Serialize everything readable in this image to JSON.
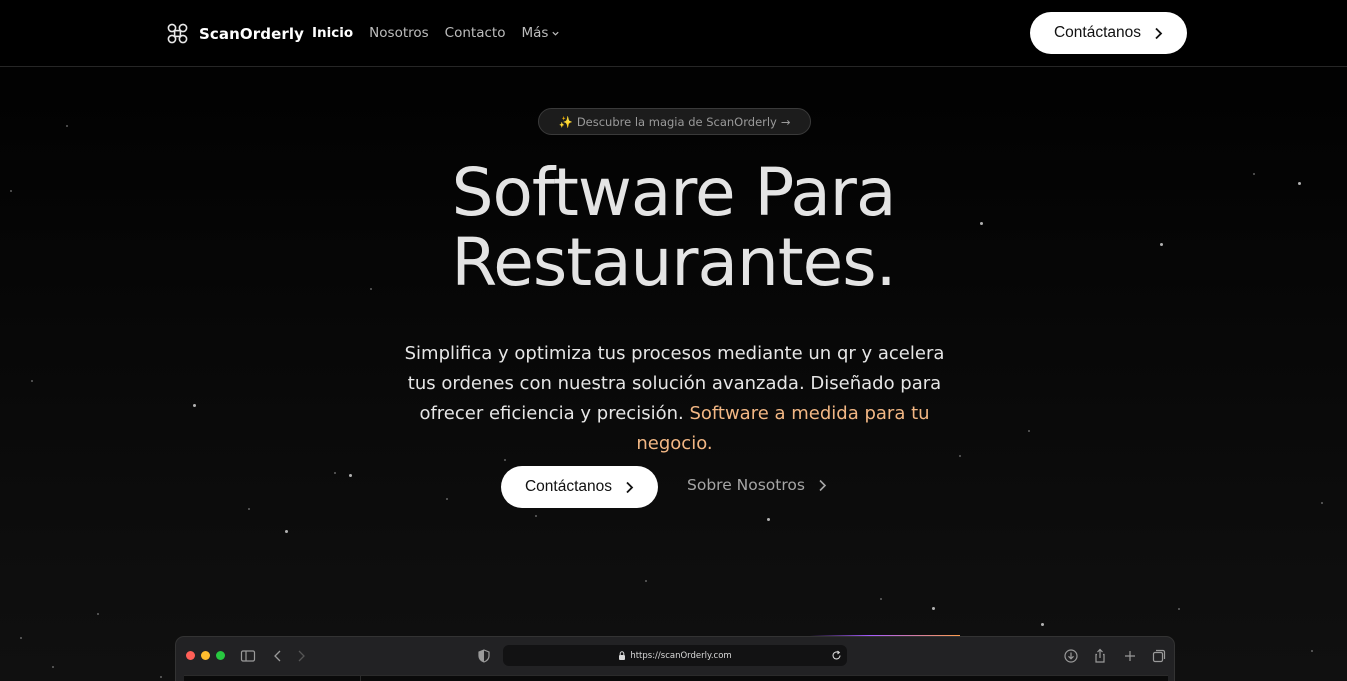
{
  "header": {
    "brand": "ScanOrderly",
    "nav": [
      {
        "label": "Inicio",
        "active": true
      },
      {
        "label": "Nosotros",
        "active": false
      },
      {
        "label": "Contacto",
        "active": false
      },
      {
        "label": "Más",
        "active": false,
        "icon": "chevron-down-icon"
      }
    ],
    "cta_label": "Contáctanos"
  },
  "announcement": {
    "emoji": "✨",
    "text": "Descubre la magia de ScanOrderly",
    "arrow": "→"
  },
  "hero": {
    "title_line1": "Software Para",
    "title_line2": "Restaurantes.",
    "subtitle": "Simplifica y optimiza tus procesos mediante un qr y acelera tus ordenes con nuestra solución avanzada. Diseñado para ofrecer eficiencia y precisión. ",
    "subtitle_accent": "Software a medida para tu negocio.",
    "primary_cta": "Contáctanos",
    "secondary_cta": "Sobre Nosotros"
  },
  "browser_mockup": {
    "url": "https://scanOrderly.com"
  },
  "colors": {
    "accent": "#f2b784",
    "background": "#000000",
    "button_bg": "#ffffff",
    "traffic_red": "#ff5f57",
    "traffic_yellow": "#febc2e",
    "traffic_green": "#28c840"
  }
}
